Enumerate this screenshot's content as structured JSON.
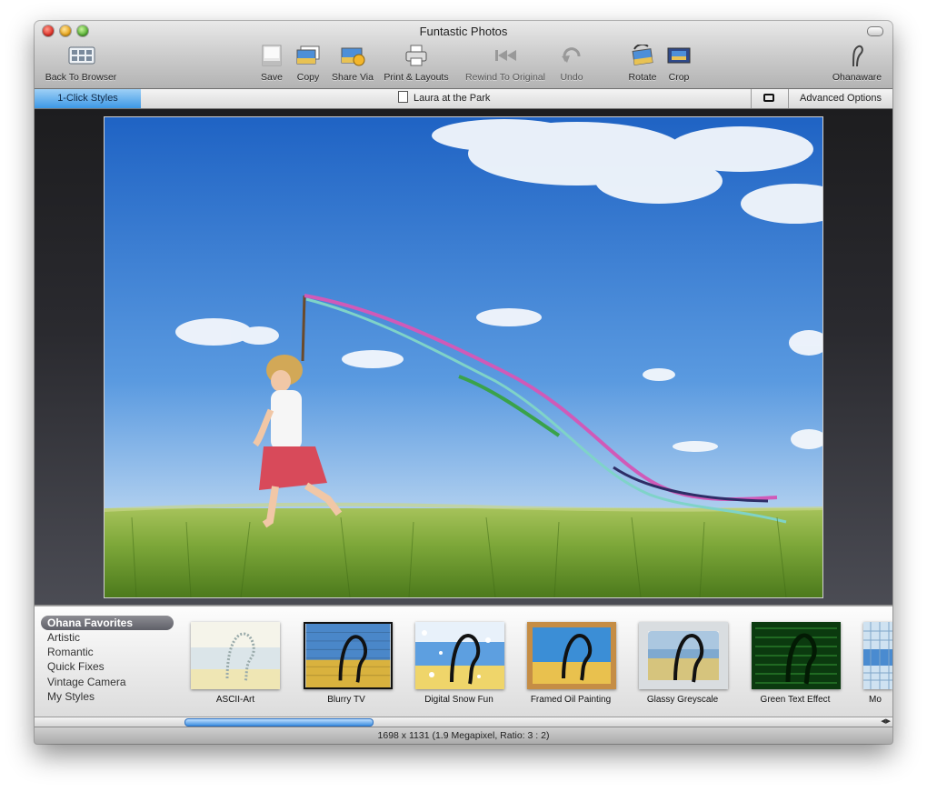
{
  "window": {
    "title": "Funtastic Photos"
  },
  "toolbar": {
    "back": "Back To Browser",
    "save": "Save",
    "copy": "Copy",
    "share": "Share Via",
    "print": "Print & Layouts",
    "rewind": "Rewind To Original",
    "undo": "Undo",
    "rotate": "Rotate",
    "crop": "Crop",
    "brand": "Ohanaware"
  },
  "tabbar": {
    "styles_tab": "1-Click Styles",
    "document_title": "Laura at the Park",
    "advanced": "Advanced Options"
  },
  "categories": [
    {
      "label": "Ohana Favorites",
      "selected": true
    },
    {
      "label": "Artistic"
    },
    {
      "label": "Romantic"
    },
    {
      "label": "Quick Fixes"
    },
    {
      "label": "Vintage Camera"
    },
    {
      "label": "My Styles"
    }
  ],
  "styles": [
    {
      "label": "ASCII-Art"
    },
    {
      "label": "Blurry TV"
    },
    {
      "label": "Digital Snow Fun"
    },
    {
      "label": "Framed Oil Painting"
    },
    {
      "label": "Glassy Greyscale"
    },
    {
      "label": "Green Text Effect"
    },
    {
      "label": "Mo"
    }
  ],
  "status": "1698 x 1131 (1.9 Megapixel, Ratio: 3 : 2)",
  "colors": {
    "accent": "#3d98e6",
    "sky": "#3f86d6",
    "grass": "#79a83a"
  }
}
